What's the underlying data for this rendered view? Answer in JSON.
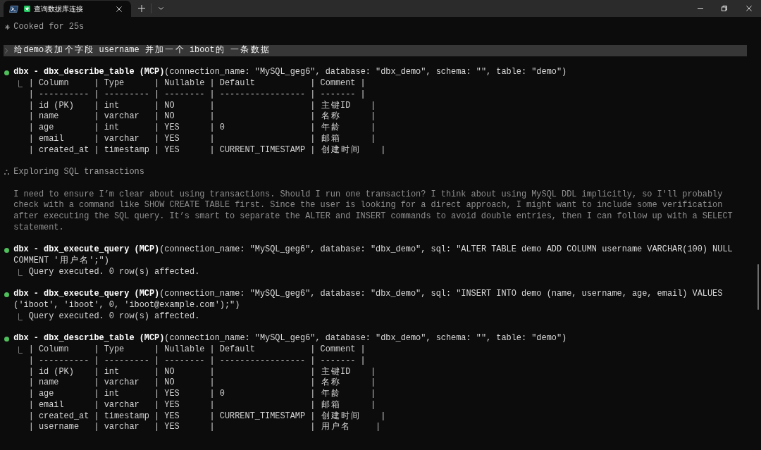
{
  "window": {
    "tabs": [
      {
        "title": "查询数据库连接",
        "selected": true
      }
    ]
  },
  "terminal": {
    "status_line": "Cooked for 25s",
    "prompt": "给demo表加个字段 username 并加一个 iboot的 一条数据",
    "entries": [
      {
        "kind": "tool_call",
        "color": "#4fbf5b",
        "call": "**dbx - dbx_describe_table (MCP)**(connection_name: \"MySQL_geg6\", database: \"dbx_demo\", schema: \"\", table: \"demo\")",
        "output": [
          "| Column     | Type      | Nullable | Default           | Comment |",
          "| ---------- | --------- | -------- | ----------------- | ------- |",
          "| id (PK)    | int       | NO       |                   | 主键ID    |",
          "| name       | varchar   | NO       |                   | 名称      |",
          "| age        | int       | YES      | 0                 | 年龄      |",
          "| email      | varchar   | YES      |                   | 邮箱      |",
          "| created_at | timestamp | YES      | CURRENT_TIMESTAMP | 创建时间    |"
        ]
      },
      {
        "kind": "thinking",
        "title": "Exploring SQL transactions",
        "text": "I need to ensure I’m clear about using transactions. Should I run one transaction? I think about using MySQL DDL implicitly, so I'll probably check with a command like SHOW CREATE TABLE first. Since the user is looking for a direct approach, I might want to include some verification after executing the SQL query. It’s smart to separate the ALTER and INSERT commands to avoid double entries, then I can follow up with a SELECT statement."
      },
      {
        "kind": "tool_call",
        "color": "#4fbf5b",
        "call": "**dbx - dbx_execute_query (MCP)**(connection_name: \"MySQL_geg6\", database: \"dbx_demo\", sql: \"ALTER TABLE demo ADD COLUMN username VARCHAR(100) NULL COMMENT '用户名';\")",
        "output": [
          "Query executed. 0 row(s) affected."
        ]
      },
      {
        "kind": "tool_call",
        "color": "#4fbf5b",
        "call": "**dbx - dbx_execute_query (MCP)**(connection_name: \"MySQL_geg6\", database: \"dbx_demo\", sql: \"INSERT INTO demo (name, username, age, email) VALUES ('iboot', 'iboot', 0, 'iboot@example.com');\")",
        "output": [
          "Query executed. 0 row(s) affected."
        ]
      },
      {
        "kind": "tool_call",
        "color": "#4fbf5b",
        "call": "**dbx - dbx_describe_table (MCP)**(connection_name: \"MySQL_geg6\", database: \"dbx_demo\", schema: \"\", table: \"demo\")",
        "output": [
          "| Column     | Type      | Nullable | Default           | Comment |",
          "| ---------- | --------- | -------- | ----------------- | ------- |",
          "| id (PK)    | int       | NO       |                   | 主键ID    |",
          "| name       | varchar   | NO       |                   | 名称      |",
          "| age        | int       | YES      | 0                 | 年龄      |",
          "| email      | varchar   | YES      |                   | 邮箱      |",
          "| created_at | timestamp | YES      | CURRENT_TIMESTAMP | 创建时间    |",
          "| username   | varchar   | YES      |                   | 用户名     |"
        ]
      }
    ]
  }
}
